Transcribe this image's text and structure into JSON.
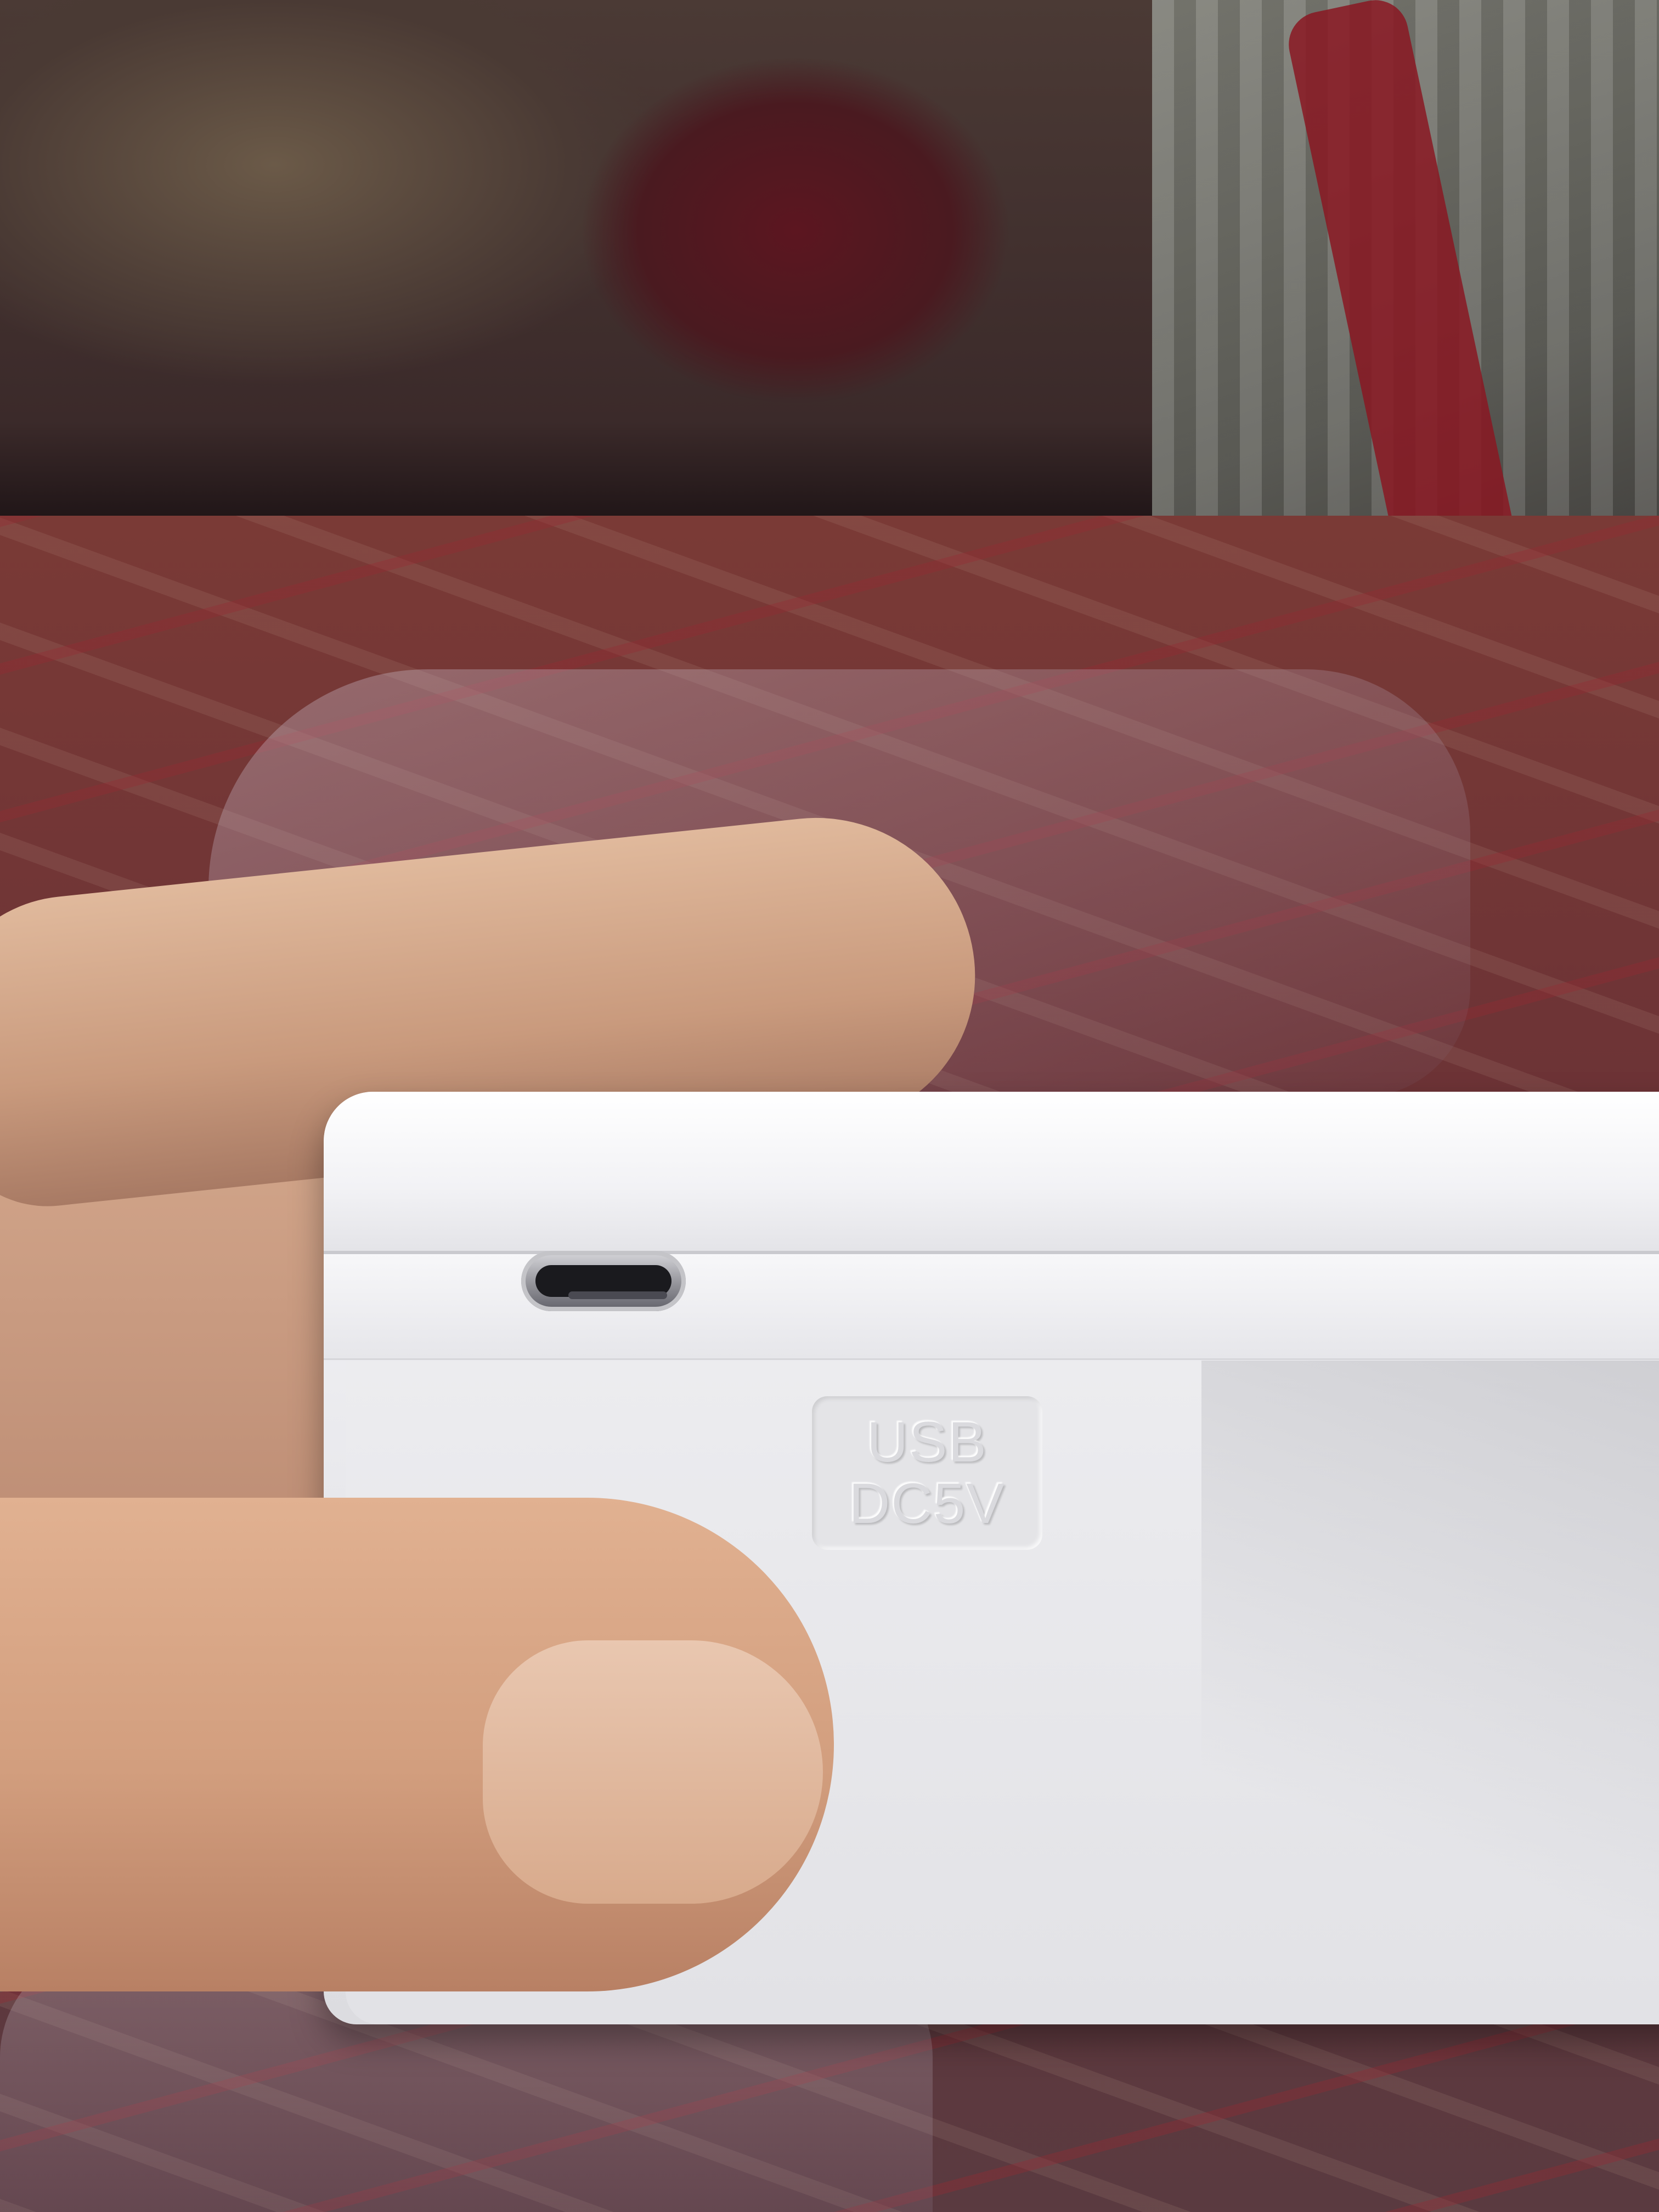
{
  "photo": {
    "device_label": {
      "line1": "USB",
      "line2": "DC5V"
    }
  }
}
